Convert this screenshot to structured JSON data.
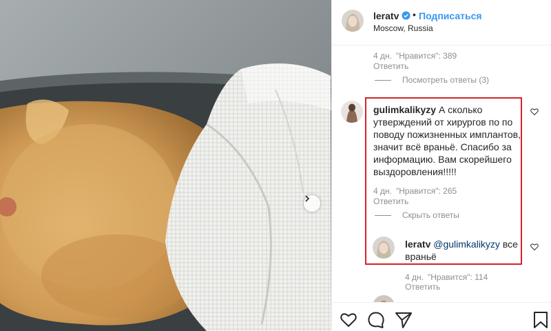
{
  "header": {
    "username": "leratv",
    "dot": "•",
    "follow_label": "Подписаться",
    "location": "Moscow, Russia"
  },
  "prev_comment": {
    "age": "4 дн.",
    "likes_text": "\"Нравится\": 389",
    "reply_label": "Ответить",
    "view_replies": "Посмотреть ответы (3)"
  },
  "comment": {
    "author": "gulimkalikyzy",
    "text": "А сколько утверждений от хирургов по по поводу пожизненных имплантов, значит всё враньё. Спасибо за информацию. Вам скорейшего выздоровления!!!!!",
    "age": "4 дн.",
    "likes_text": "\"Нравится\": 265",
    "reply_label": "Ответить",
    "hide_replies": "Скрыть ответы"
  },
  "reply": {
    "author": "leratv",
    "mention": "@gulimkalikyzy",
    "text": "все враньё",
    "age": "4 дн.",
    "likes_text": "\"Нравится\": 114",
    "reply_label": "Ответить"
  },
  "icons": [
    "verified-badge-icon",
    "heart-icon",
    "comment-icon",
    "share-icon",
    "bookmark-icon",
    "chevron-right-icon"
  ],
  "colors": {
    "accent": "#3897f0",
    "highlight": "#d62129",
    "muted": "#8e8e8e"
  }
}
